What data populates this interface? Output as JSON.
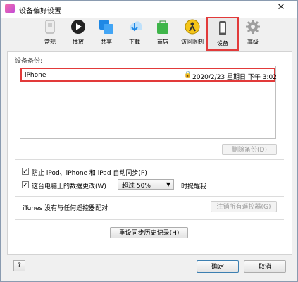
{
  "window": {
    "title": "设备偏好设置",
    "close_label": "✕"
  },
  "toolbar": {
    "items": [
      {
        "label": "常规"
      },
      {
        "label": "播放"
      },
      {
        "label": "共享"
      },
      {
        "label": "下载"
      },
      {
        "label": "商店"
      },
      {
        "label": "访问限制"
      },
      {
        "label": "设备",
        "selected": true
      },
      {
        "label": "高级"
      }
    ]
  },
  "backups": {
    "section_label": "设备备份:",
    "rows": [
      {
        "name": "iPhone",
        "date": "2020/2/23 星期日 下午 3:02",
        "locked": true
      }
    ],
    "delete_button": "删除备份(D)"
  },
  "options": {
    "prevent_sync_label": "防止 iPod、iPhone 和 iPad 自动同步(P)",
    "prevent_sync_checked": true,
    "warn_label": "这台电脑上的数据更改(W)",
    "warn_checked": true,
    "threshold_value": "超过 50%",
    "warn_suffix": "时提醒我"
  },
  "remotes": {
    "status_text": "iTunes 没有与任何遥控器配对",
    "forget_button": "注销所有遥控器(G)"
  },
  "reset_sync_button": "重设同步历史记录(H)",
  "footer": {
    "help_label": "?",
    "ok_label": "确定",
    "cancel_label": "取消"
  },
  "colors": {
    "highlight": "#e23a3a"
  }
}
